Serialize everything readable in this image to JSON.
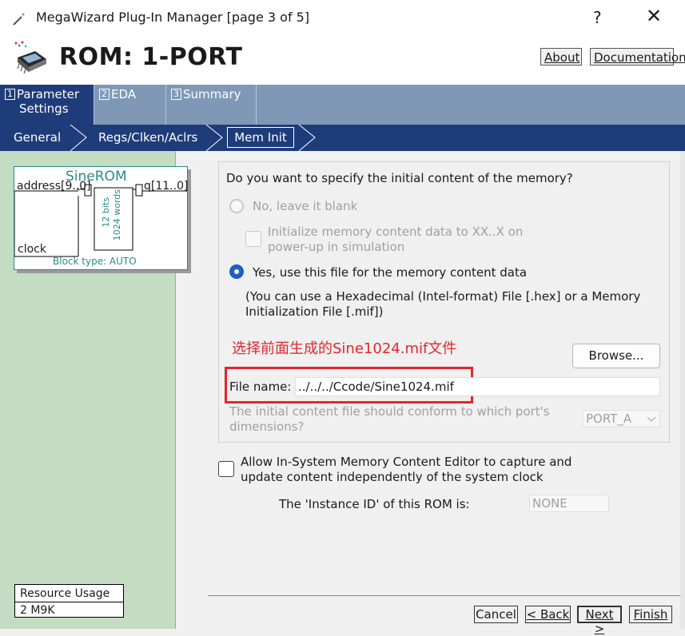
{
  "window": {
    "title": "MegaWizard Plug-In Manager [page 3 of 5]",
    "help_glyph": "?",
    "close_glyph": "✕"
  },
  "header": {
    "title": "ROM: 1-PORT",
    "about_label": "About",
    "documentation_label": "Documentation"
  },
  "tabs": [
    {
      "num": "1",
      "label_line1": "Parameter",
      "label_line2": "Settings",
      "active": true
    },
    {
      "num": "2",
      "label_line1": "EDA",
      "active": false
    },
    {
      "num": "3",
      "label_line1": "Summary",
      "active": false
    }
  ],
  "subtabs": [
    {
      "label": "General"
    },
    {
      "label": "Regs/Clken/Aclrs"
    },
    {
      "label": "Mem Init",
      "active": true
    }
  ],
  "symbol": {
    "name": "SineROM",
    "port_address": "address[9..0]",
    "port_q": "q[11..0]",
    "port_clock": "clock",
    "bits_label": "12 bits",
    "words_label": "1024 words",
    "block_type": "Block type: AUTO"
  },
  "resource": {
    "heading": "Resource Usage",
    "value": "2 M9K"
  },
  "memory_init": {
    "question": "Do you want to specify the initial content of the memory?",
    "option_no": "No, leave it blank",
    "init_xx_line1": "Initialize memory content data to XX..X on",
    "init_xx_line2": "power-up in simulation",
    "option_yes": "Yes, use this file for the memory content data",
    "hint_line1": "(You can use a Hexadecimal (Intel-format) File [.hex] or a Memory",
    "hint_line2": "Initialization File [.mif])",
    "annotation": "选择前面生成的Sine1024.mif文件",
    "browse_label": "Browse...",
    "file_name_label": "File name:",
    "file_name_value": "../../../Ccode/Sine1024.mif",
    "conform_line1": "The initial content file should conform to which port's",
    "conform_line2": "dimensions?",
    "port_value": "PORT_A"
  },
  "insystem": {
    "line1": "Allow In-System Memory Content Editor to capture and",
    "line2": "update content independently of the system clock",
    "instance_label": "The 'Instance ID' of this ROM is:",
    "instance_value": "NONE"
  },
  "footer": {
    "cancel": "Cancel",
    "back": "< Back",
    "next": "Next >",
    "finish": "Finish"
  },
  "colors": {
    "tab_bar": "#7f98b6",
    "active_tab": "#1f3c7a",
    "left_panel": "#c4dcc2",
    "radio_selected": "#1f5fbf",
    "annotation_red": "#e3262c"
  }
}
